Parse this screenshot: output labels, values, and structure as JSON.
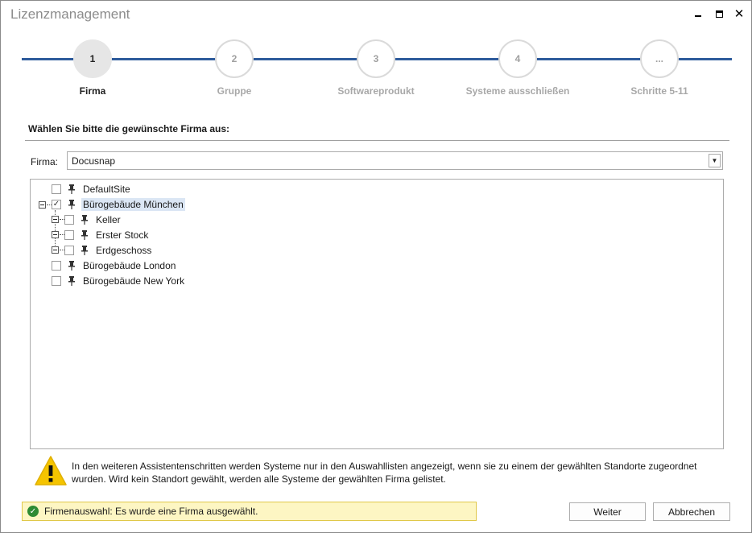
{
  "window": {
    "title": "Lizenzmanagement"
  },
  "steps": [
    {
      "number": "1",
      "label": "Firma",
      "active": true
    },
    {
      "number": "2",
      "label": "Gruppe",
      "active": false
    },
    {
      "number": "3",
      "label": "Softwareprodukt",
      "active": false
    },
    {
      "number": "4",
      "label": "Systeme ausschließen",
      "active": false
    },
    {
      "number": "...",
      "label": "Schritte 5-11",
      "active": false
    }
  ],
  "instruction": "Wählen Sie bitte die gewünschte Firma aus:",
  "firma": {
    "label": "Firma:",
    "value": "Docusnap"
  },
  "tree": [
    {
      "label": "DefaultSite",
      "checked": false
    },
    {
      "label": "Bürogebäude München",
      "checked": true,
      "selected": true,
      "expanded": true
    },
    {
      "label": "Keller",
      "checked": false
    },
    {
      "label": "Erster Stock",
      "checked": false
    },
    {
      "label": "Erdgeschoss",
      "checked": false
    },
    {
      "label": "Bürogebäude London",
      "checked": false
    },
    {
      "label": "Bürogebäude New York",
      "checked": false
    }
  ],
  "warning": "In den weiteren Assistentenschritten werden Systeme nur in den Auswahllisten angezeigt, wenn sie zu einem der gewählten Standorte zugeordnet wurden. Wird kein Standort gewählt, werden alle Systeme der gewählten Firma gelistet.",
  "status": "Firmenauswahl: Es wurde eine Firma ausgewählt.",
  "buttons": {
    "next": "Weiter",
    "cancel": "Abbrechen"
  },
  "colors": {
    "step_line": "#2e5b9c",
    "status_bg": "#fdf6c3",
    "warning_icon": "#f5c400",
    "selected_bg": "#dbe6f4"
  }
}
